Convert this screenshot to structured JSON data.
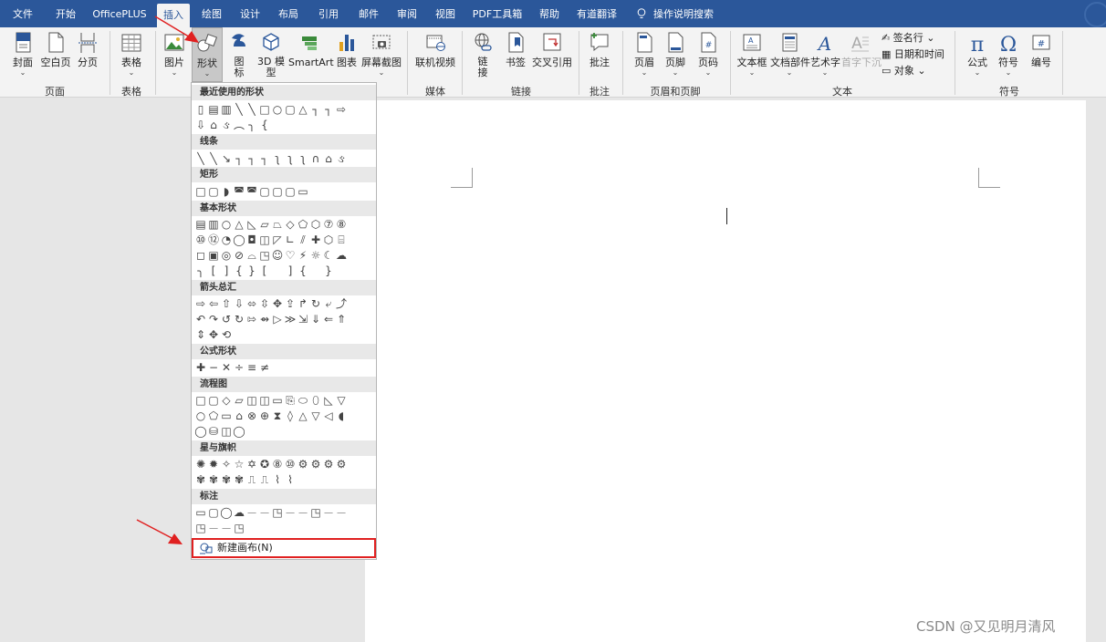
{
  "tabs": [
    "文件",
    "开始",
    "OfficePLUS",
    "插入",
    "绘图",
    "设计",
    "布局",
    "引用",
    "邮件",
    "审阅",
    "视图",
    "PDF工具箱",
    "帮助",
    "有道翻译"
  ],
  "active_tab": "插入",
  "tell_me": "操作说明搜索",
  "ribbon": {
    "buttons": {
      "cover": "封面",
      "blank": "空白页",
      "pagebreak": "分页",
      "table": "表格",
      "pictures": "图片",
      "shapes": "形状",
      "icons": "图\n标",
      "model3d": "3D 模\n型",
      "smartart": "SmartArt",
      "chart": "图表",
      "screenshot": "屏幕截图",
      "onlinevideo": "联机视频",
      "link": "链\n接",
      "bookmark": "书签",
      "crossref": "交叉引用",
      "comment": "批注",
      "header": "页眉",
      "footer": "页脚",
      "pagenum": "页码",
      "textbox": "文本框",
      "quickparts": "文档部件",
      "wordart": "艺术字",
      "dropcap": "首字下沉",
      "signature": "签名行",
      "datetime": "日期和时间",
      "object": "对象",
      "equation": "公式",
      "symbol": "符号",
      "number": "编号"
    },
    "groups": {
      "pages": "页面",
      "tables": "表格",
      "media": "媒体",
      "links": "链接",
      "comments": "批注",
      "headerfooter": "页眉和页脚",
      "text": "文本",
      "symbols": "符号"
    }
  },
  "shapes_menu": {
    "sections": [
      "最近使用的形状",
      "线条",
      "矩形",
      "基本形状",
      "箭头总汇",
      "公式形状",
      "流程图",
      "星与旗帜",
      "标注"
    ],
    "new_canvas": "新建画布(N)"
  },
  "watermark": "CSDN @又见明月清风",
  "colors": {
    "ribbon_blue": "#2b579a",
    "highlight": "#e02020"
  }
}
